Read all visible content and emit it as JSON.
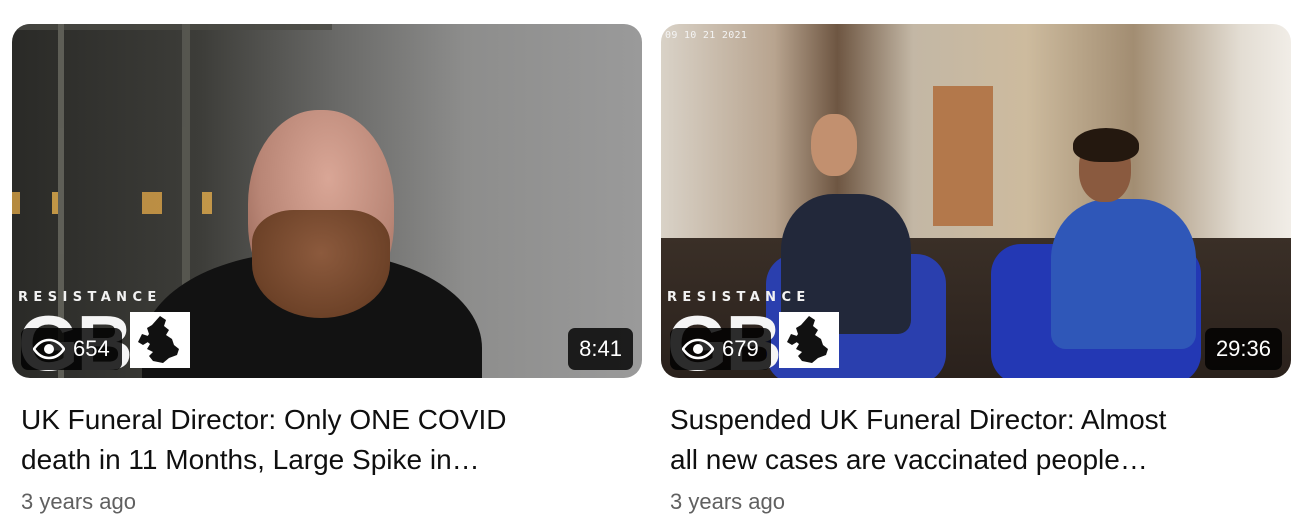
{
  "videos": [
    {
      "title_line1": "UK Funeral Director: Only ONE COVID",
      "title_line2": "death in 11 Months, Large Spike in…",
      "views": "654",
      "duration": "8:41",
      "age": "3 years ago",
      "watermark_text": "RESISTANCE",
      "watermark_logo": "GB",
      "thumbnail_timestamp": ""
    },
    {
      "title_line1": "Suspended UK Funeral Director: Almost",
      "title_line2": "all new cases are vaccinated people…",
      "views": "679",
      "duration": "29:36",
      "age": "3 years ago",
      "watermark_text": "RESISTANCE",
      "watermark_logo": "GB",
      "thumbnail_timestamp": "09 10 21 2021"
    }
  ],
  "colors": {
    "title": "#0f0f0f",
    "meta": "#606060",
    "badge_bg": "rgba(0,0,0,0.82)",
    "badge_text": "#ffffff"
  },
  "icons": {
    "views": "eye-icon",
    "watermark_map": "uk-map-icon"
  }
}
